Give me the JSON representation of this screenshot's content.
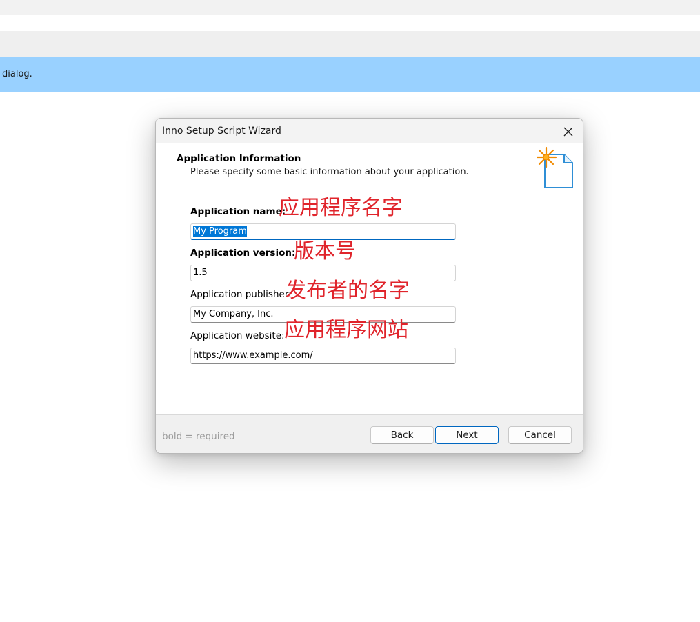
{
  "background": {
    "banner_text": "dialog."
  },
  "dialog": {
    "title": "Inno Setup Script Wizard",
    "header": {
      "title": "Application Information",
      "subtitle": "Please specify some basic information about your application."
    },
    "fields": [
      {
        "label": "Application name:",
        "value": "My Program",
        "annotation": "应用程序名字",
        "required": true
      },
      {
        "label": "Application version:",
        "value": "1.5",
        "annotation": "版本号",
        "required": true
      },
      {
        "label": "Application publisher:",
        "value": "My Company, Inc.",
        "annotation": "发布者的名字",
        "required": false
      },
      {
        "label": "Application website:",
        "value": "https://www.example.com/",
        "annotation": "应用程序网站",
        "required": false
      }
    ],
    "footer": {
      "note_bold": "bold",
      "note_rest": " = required",
      "back_label": "Back",
      "next_label": "Next",
      "cancel_label": "Cancel"
    }
  },
  "colors": {
    "banner": "#99d1ff",
    "annotation": "#e0242b",
    "accent": "#0067c0",
    "selection": "#0078d7"
  },
  "icons": {
    "close": "close-icon",
    "wizard": "new-script-wizard-icon"
  }
}
